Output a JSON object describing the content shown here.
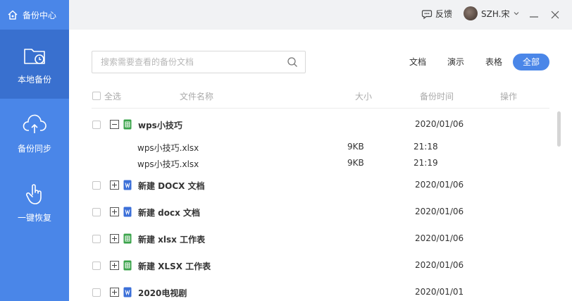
{
  "app": {
    "title": "备份中心"
  },
  "sidebar": {
    "items": [
      {
        "label": "本地备份",
        "icon": "folder-clock-icon",
        "active": true
      },
      {
        "label": "备份同步",
        "icon": "cloud-upload-icon",
        "active": false
      },
      {
        "label": "一键恢复",
        "icon": "hand-pointer-icon",
        "active": false
      }
    ]
  },
  "topbar": {
    "feedback_label": "反馈",
    "username": "SZH.宋"
  },
  "search": {
    "placeholder": "搜索需要查看的备份文档"
  },
  "filters": [
    {
      "label": "文档",
      "active": false
    },
    {
      "label": "演示",
      "active": false
    },
    {
      "label": "表格",
      "active": false
    },
    {
      "label": "全部",
      "active": true
    }
  ],
  "table": {
    "headers": {
      "select_all": "全选",
      "file_name": "文件名称",
      "size": "大小",
      "backup_time": "备份时间",
      "actions": "操作"
    },
    "groups": [
      {
        "name": "wps小技巧",
        "date": "2020/01/06",
        "type": "xlsx",
        "expanded": true,
        "children": [
          {
            "name": "wps小技巧.xlsx",
            "size": "9KB",
            "time": "21:18"
          },
          {
            "name": "wps小技巧.xlsx",
            "size": "9KB",
            "time": "21:19"
          }
        ]
      },
      {
        "name": "新建 DOCX 文档",
        "date": "2020/01/06",
        "type": "docx",
        "expanded": false
      },
      {
        "name": "新建 docx 文档",
        "date": "2020/01/06",
        "type": "docx",
        "expanded": false
      },
      {
        "name": "新建 xlsx 工作表",
        "date": "2020/01/06",
        "type": "xlsx",
        "expanded": false
      },
      {
        "name": "新建 XLSX 工作表",
        "date": "2020/01/06",
        "type": "xlsx",
        "expanded": false
      },
      {
        "name": "2020电视剧",
        "date": "2020/01/01",
        "type": "docx",
        "expanded": false
      }
    ]
  },
  "colors": {
    "accent": "#4a86e8",
    "sidebar_active": "#3970cf",
    "xlsx_icon": "#3aa34a",
    "docx_icon": "#3b6fd8"
  }
}
